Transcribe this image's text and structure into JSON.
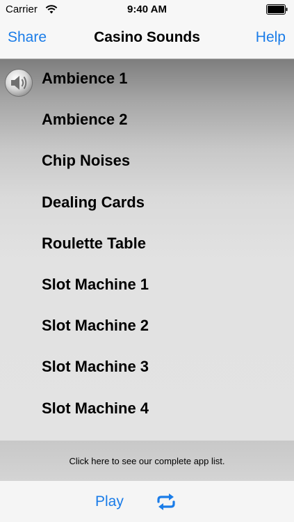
{
  "status_bar": {
    "carrier": "Carrier",
    "time": "9:40 AM"
  },
  "nav": {
    "left_button": "Share",
    "title": "Casino Sounds",
    "right_button": "Help"
  },
  "sounds": [
    {
      "label": "Ambience 1",
      "playing": true
    },
    {
      "label": "Ambience 2",
      "playing": false
    },
    {
      "label": "Chip Noises",
      "playing": false
    },
    {
      "label": "Dealing Cards",
      "playing": false
    },
    {
      "label": "Roulette Table",
      "playing": false
    },
    {
      "label": "Slot Machine 1",
      "playing": false
    },
    {
      "label": "Slot Machine 2",
      "playing": false
    },
    {
      "label": "Slot Machine 3",
      "playing": false
    },
    {
      "label": "Slot Machine 4",
      "playing": false
    }
  ],
  "ad_banner": {
    "text": "Click here to see our complete app list."
  },
  "toolbar": {
    "play_label": "Play",
    "repeat_icon": "repeat-icon"
  },
  "colors": {
    "accent": "#1a7ce8"
  }
}
